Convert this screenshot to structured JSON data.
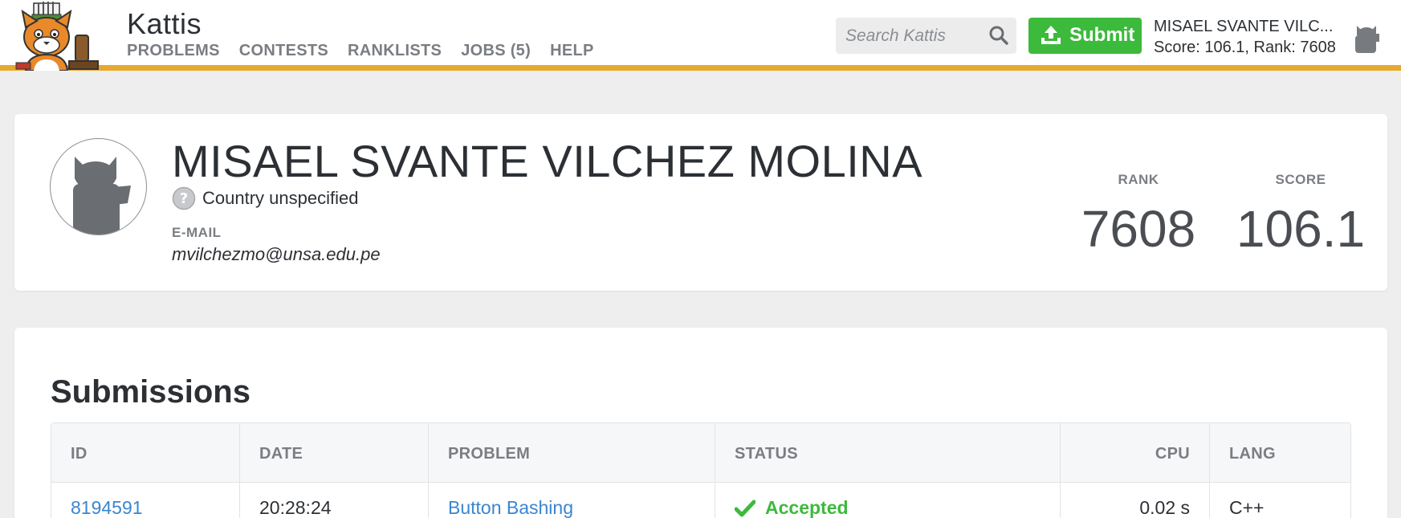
{
  "header": {
    "brand": "Kattis",
    "nav": [
      {
        "label": "PROBLEMS"
      },
      {
        "label": "CONTESTS"
      },
      {
        "label": "RANKLISTS"
      },
      {
        "label": "JOBS (5)"
      },
      {
        "label": "HELP"
      }
    ],
    "search_placeholder": "Search Kattis",
    "submit_label": "Submit",
    "user_name": "MISAEL SVANTE VILC...",
    "user_score_rank": "Score: 106.1, Rank: 7608",
    "icons": [
      "kattis-logo",
      "search-icon",
      "upload-icon",
      "user-avatar-icon"
    ]
  },
  "profile": {
    "name": "MISAEL SVANTE VILCHEZ MOLINA",
    "country": "Country unspecified",
    "email_label": "E-MAIL",
    "email": "mvilchezmo@unsa.edu.pe",
    "rank_label": "RANK",
    "rank": "7608",
    "score_label": "SCORE",
    "score": "106.1"
  },
  "submissions": {
    "title": "Submissions",
    "columns": [
      "ID",
      "DATE",
      "PROBLEM",
      "STATUS",
      "CPU",
      "LANG"
    ],
    "rows": [
      {
        "id": "8194591",
        "date": "20:28:24",
        "problem": "Button Bashing",
        "status": "Accepted",
        "cpu": "0.02 s",
        "lang": "C++"
      }
    ]
  },
  "colors": {
    "accent_bar": "#e8a82c",
    "submit_green": "#3cba3c",
    "link_blue": "#3a86cf",
    "accepted_green": "#3cba3c"
  }
}
